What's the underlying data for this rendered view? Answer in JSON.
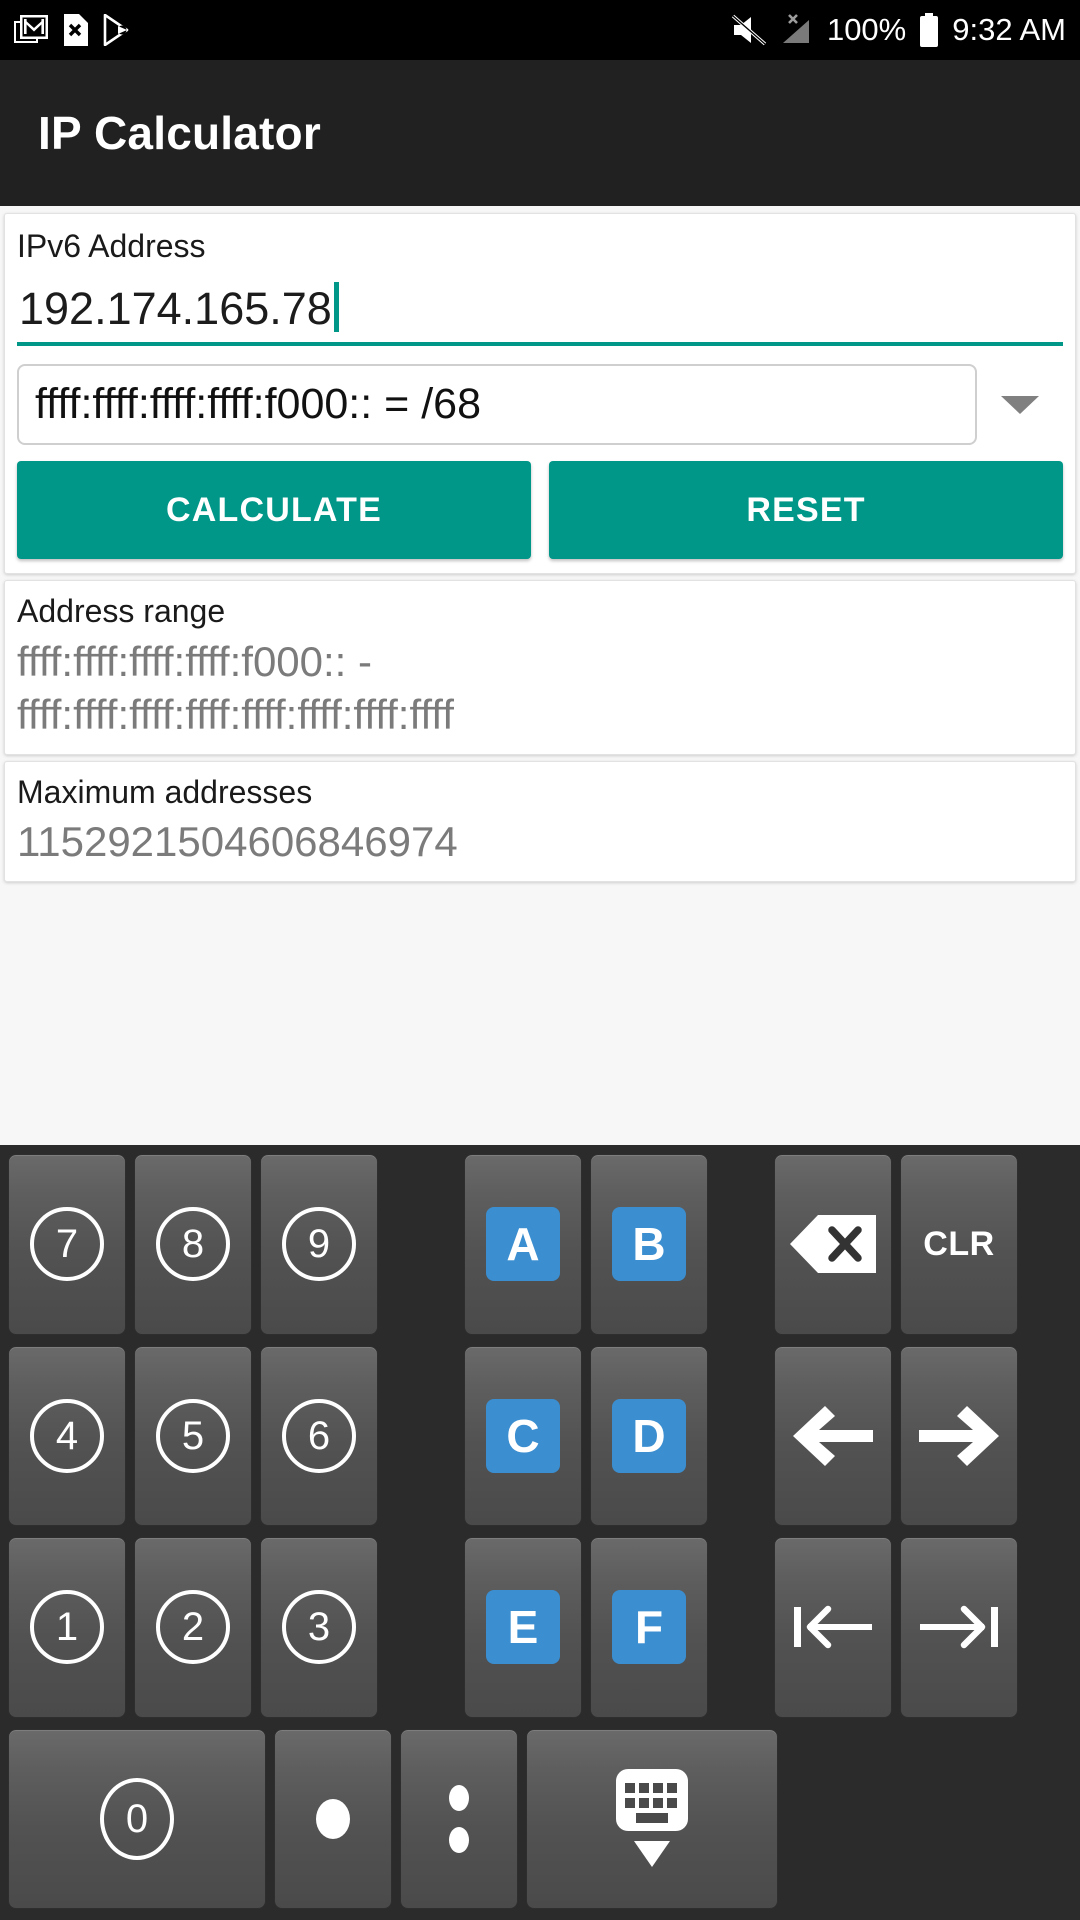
{
  "statusbar": {
    "icons_left": [
      "gmail-icon",
      "file-x-icon",
      "play-store-icon"
    ],
    "icons_right": [
      "mute-icon",
      "signal-no-service-icon",
      "battery-icon"
    ],
    "battery_text": "100%",
    "time": "9:32 AM"
  },
  "appbar": {
    "title": "IP Calculator"
  },
  "form": {
    "address_label": "IPv6 Address",
    "address_value": "192.174.165.78",
    "address_placeholder": "IPv6 Address",
    "netmask_selected": "ffff:ffff:ffff:ffff:f000:: = /68",
    "calculate_label": "CALCULATE",
    "reset_label": "RESET"
  },
  "results": [
    {
      "label": "Address range",
      "value": "ffff:ffff:ffff:ffff:f000:: -\nffff:ffff:ffff:ffff:ffff:ffff:ffff:ffff",
      "line1": "ffff:ffff:ffff:ffff:f000:: -",
      "line2": "ffff:ffff:ffff:ffff:ffff:ffff:ffff:ffff"
    },
    {
      "label": "Maximum addresses",
      "value": "1152921504606846974"
    }
  ],
  "keypad": {
    "row1": {
      "d7": "7",
      "d8": "8",
      "d9": "9",
      "hexA": "A",
      "hexB": "B",
      "backspace_icon": "backspace-icon",
      "clr": "CLR"
    },
    "row2": {
      "d4": "4",
      "d5": "5",
      "d6": "6",
      "hexC": "C",
      "hexD": "D",
      "left_icon": "arrow-left-icon",
      "right_icon": "arrow-right-icon"
    },
    "row3": {
      "d1": "1",
      "d2": "2",
      "d3": "3",
      "hexE": "E",
      "hexF": "F",
      "home_icon": "arrow-to-start-icon",
      "end_icon": "arrow-to-end-icon"
    },
    "row4": {
      "d0": "0",
      "dot_icon": "dot-icon",
      "colon_icon": "colon-icon",
      "hide_icon": "hide-keyboard-icon"
    }
  },
  "colors": {
    "accent": "#009688",
    "hex_key": "#3b8ed0",
    "appbar": "#212121",
    "keypad_bg": "#2b2b2b"
  }
}
